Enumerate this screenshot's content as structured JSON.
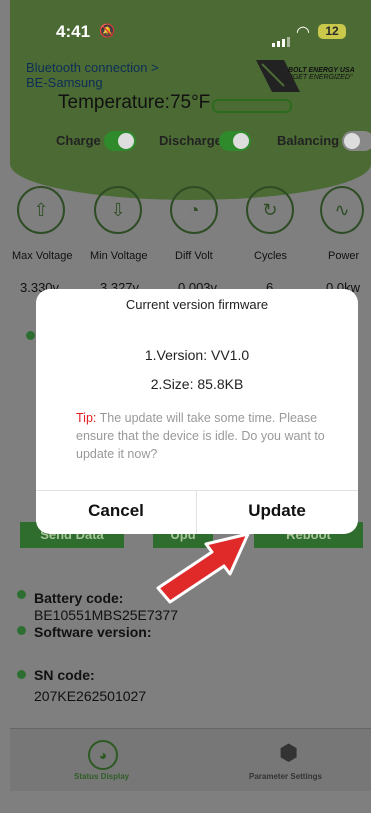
{
  "status_bar": {
    "time": "4:41",
    "battery": "12"
  },
  "header": {
    "connection_line1": "Bluetooth connection >",
    "connection_line2": "BE-Samsung",
    "brand": "BOLT ENERGY USA",
    "brand_tagline": "\"GET ENERGIZED\"",
    "temperature": "Temperature:75°F"
  },
  "controls": [
    {
      "label": "Charge",
      "on": true
    },
    {
      "label": "Discharge",
      "on": true
    },
    {
      "label": "Balancing",
      "on": false
    }
  ],
  "stats": [
    {
      "label": "Max Voltage",
      "value": "3.330v",
      "icon": "max-voltage-icon"
    },
    {
      "label": "Min Voltage",
      "value": "3.327v",
      "icon": "min-voltage-icon"
    },
    {
      "label": "Diff Volt",
      "value": "0.003v",
      "icon": "gauge-icon"
    },
    {
      "label": "Cycles",
      "value": "6",
      "icon": "cycle-icon"
    },
    {
      "label": "Power",
      "value": "0.0kw",
      "icon": "power-icon"
    }
  ],
  "actions": {
    "send_data": "Send Data",
    "update": "Upd",
    "reboot": "Reboot"
  },
  "info": {
    "battery_code_label": "Battery code:",
    "battery_code": "BE10551MBS25E7377",
    "software_version_label": "Software version:",
    "sn_code_label": "SN code:",
    "sn_code": "207KE262501027"
  },
  "tabs": [
    {
      "label": "Status Display",
      "icon": "status-display-icon",
      "active": true
    },
    {
      "label": "Parameter Settings",
      "icon": "gear-icon",
      "active": false
    }
  ],
  "modal": {
    "title": "Current version firmware",
    "version": "1.Version: VV1.0",
    "size": "2.Size: 85.8KB",
    "tip_label": "Tip:",
    "tip_text": " The update will take some time. Please ensure that the device is idle. Do you want to update it now?",
    "cancel": "Cancel",
    "update": "Update"
  },
  "colors": {
    "brand_green": "#4c6b34",
    "tip_red": "#e21e1e",
    "arrow_red": "#e02a2a"
  }
}
